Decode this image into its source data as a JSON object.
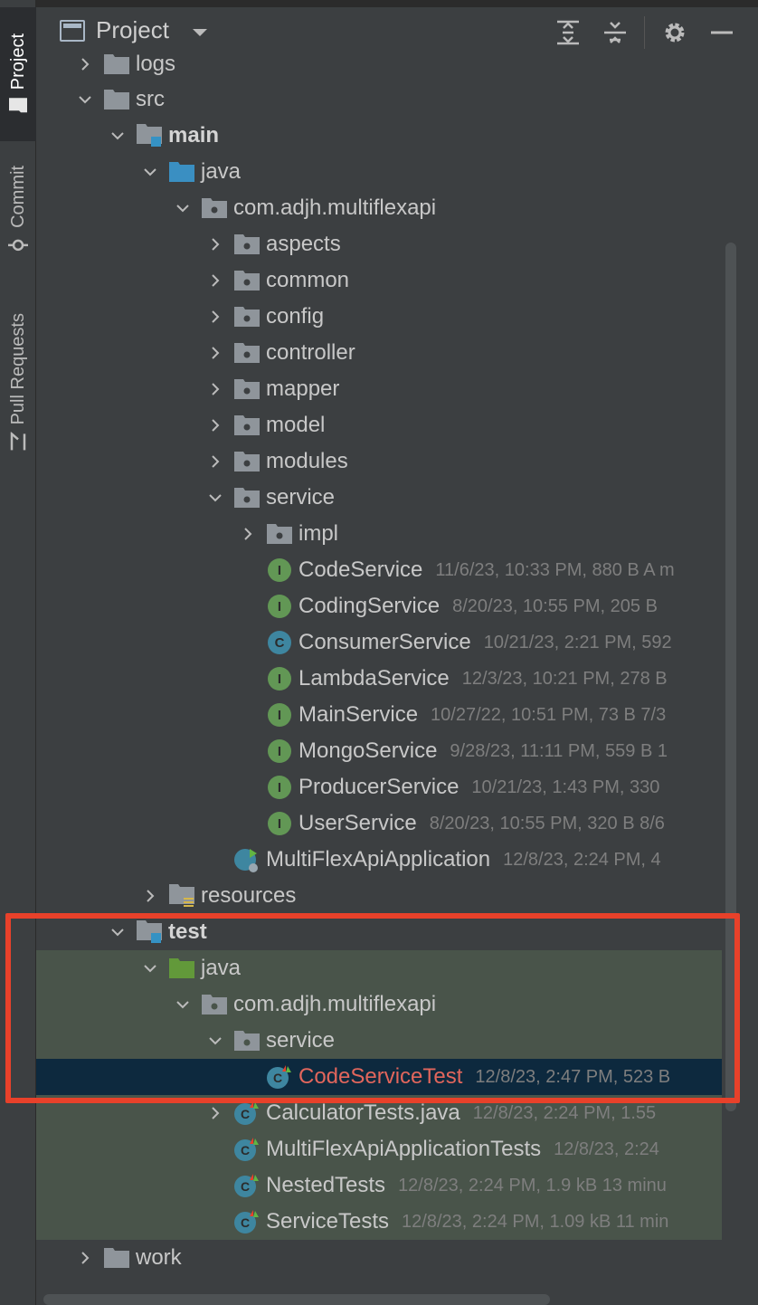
{
  "sidebar": {
    "project_label": "Project",
    "commit_label": "Commit",
    "pull_requests_label": "Pull Requests"
  },
  "header": {
    "title": "Project",
    "icons": [
      "expand-all-icon",
      "collapse-all-icon",
      "gear-icon",
      "minimize-icon"
    ]
  },
  "tree": {
    "logs": "logs",
    "src": "src",
    "main": "main",
    "main_java": "java",
    "main_pkg": "com.adjh.multiflexapi",
    "aspects": "aspects",
    "common": "common",
    "config": "config",
    "controller": "controller",
    "mapper": "mapper",
    "model": "model",
    "modules": "modules",
    "service": "service",
    "impl": "impl",
    "code_service": "CodeService",
    "code_service_meta": "11/6/23, 10:33 PM, 880 B A m",
    "coding_service": "CodingService",
    "coding_service_meta": "8/20/23, 10:55 PM, 205 B",
    "consumer_service": "ConsumerService",
    "consumer_service_meta": "10/21/23, 2:21 PM, 592",
    "lambda_service": "LambdaService",
    "lambda_service_meta": "12/3/23, 10:21 PM, 278 B",
    "main_service": "MainService",
    "main_service_meta": "10/27/22, 10:51 PM, 73 B 7/3",
    "mongo_service": "MongoService",
    "mongo_service_meta": "9/28/23, 11:11 PM, 559 B 1",
    "producer_service": "ProducerService",
    "producer_service_meta": "10/21/23, 1:43 PM, 330",
    "user_service": "UserService",
    "user_service_meta": "8/20/23, 10:55 PM, 320 B 8/6",
    "app": "MultiFlexApiApplication",
    "app_meta": "12/8/23, 2:24 PM, 4",
    "resources": "resources",
    "test": "test",
    "test_java": "java",
    "test_pkg": "com.adjh.multiflexapi",
    "test_service": "service",
    "code_service_test": "CodeServiceTest",
    "code_service_test_meta": "12/8/23, 2:47 PM, 523 B",
    "calculator_tests": "CalculatorTests.java",
    "calculator_tests_meta": "12/8/23, 2:24 PM, 1.55",
    "app_tests": "MultiFlexApiApplicationTests",
    "app_tests_meta": "12/8/23, 2:24",
    "nested_tests": "NestedTests",
    "nested_tests_meta": "12/8/23, 2:24 PM, 1.9 kB 13 minu",
    "service_tests": "ServiceTests",
    "service_tests_meta": "12/8/23, 2:24 PM, 1.09 kB 11 min",
    "work": "work"
  },
  "colors": {
    "background": "#3c3f41",
    "test_background": "#49544a",
    "selection": "#0d293e",
    "highlight_border": "#e8412a",
    "interface_badge": "#629755",
    "class_badge": "#3e86a0"
  }
}
